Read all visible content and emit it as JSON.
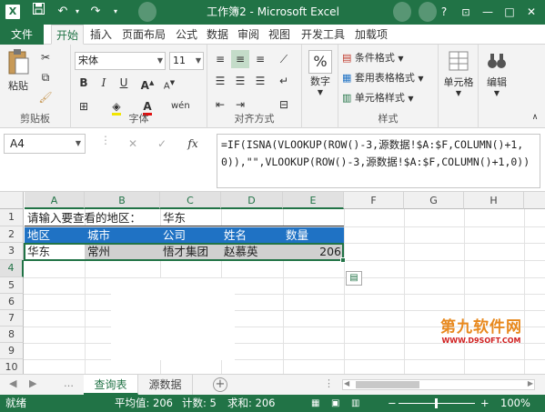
{
  "window": {
    "title": "工作簿2 - Microsoft Excel",
    "app_logo": "X",
    "qat": {
      "save_icon": "save-icon",
      "undo_icon": "undo-icon",
      "redo_icon": "redo-icon",
      "customize_icon": "customize-icon"
    },
    "controls": {
      "help": "?",
      "ribbon_opts": "⊡",
      "minimize": "—",
      "maximize": "□",
      "close": "✕"
    }
  },
  "tabs": {
    "file": "文件",
    "items": [
      "开始",
      "插入",
      "页面布局",
      "公式",
      "数据",
      "审阅",
      "视图",
      "开发工具",
      "加载项"
    ],
    "active": "开始"
  },
  "ribbon": {
    "clipboard": {
      "label": "剪贴板",
      "paste": "粘贴"
    },
    "font": {
      "label": "字体",
      "name": "宋体",
      "size": "11",
      "bold": "B",
      "italic": "I",
      "underline": "U"
    },
    "alignment": {
      "label": "对齐方式"
    },
    "number": {
      "label": "",
      "button": "数字",
      "icon_text": "%"
    },
    "styles": {
      "label": "样式",
      "conditional": "条件格式",
      "table": "套用表格格式",
      "cell_styles": "单元格样式"
    },
    "cells": {
      "button": "单元格"
    },
    "editing": {
      "button": "编辑"
    }
  },
  "formula_bar": {
    "name_box": "A4",
    "cancel": "✕",
    "enter": "✓",
    "fx": "fx",
    "formula": "=IF(ISNA(VLOOKUP(ROW()-3,源数据!$A:$F,COLUMN()+1,0)),\"\",VLOOKUP(ROW()-3,源数据!$A:$F,COLUMN()+1,0))"
  },
  "grid": {
    "columns": [
      "A",
      "B",
      "C",
      "D",
      "E",
      "F",
      "G",
      "H"
    ],
    "rows": [
      "1",
      "2",
      "3",
      "4",
      "5",
      "6",
      "7",
      "8",
      "9",
      "10",
      "11"
    ],
    "cells": {
      "a1": "请输入要查看的地区：",
      "c1": "华东",
      "a3": "地区",
      "b3": "城市",
      "c3": "公司",
      "d3": "姓名",
      "e3": "数量",
      "a4": "华东",
      "b4": "常州",
      "c4": "悟才集团",
      "d4": "赵慕英",
      "e4": "206"
    },
    "watermark": {
      "main": "第九软件网",
      "sub": "WWW.D9SOFT.COM"
    }
  },
  "sheets": {
    "tabs": [
      "查询表",
      "源数据"
    ],
    "active": "查询表",
    "add": "+"
  },
  "status": {
    "ready": "就绪",
    "average": "平均值: 206",
    "count": "计数: 5",
    "sum": "求和: 206",
    "zoom_minus": "−",
    "zoom_plus": "+",
    "zoom": "100%"
  },
  "colors": {
    "accent": "#217346",
    "header_band": "#1f72c4",
    "row_band": "#d0d0d0"
  }
}
